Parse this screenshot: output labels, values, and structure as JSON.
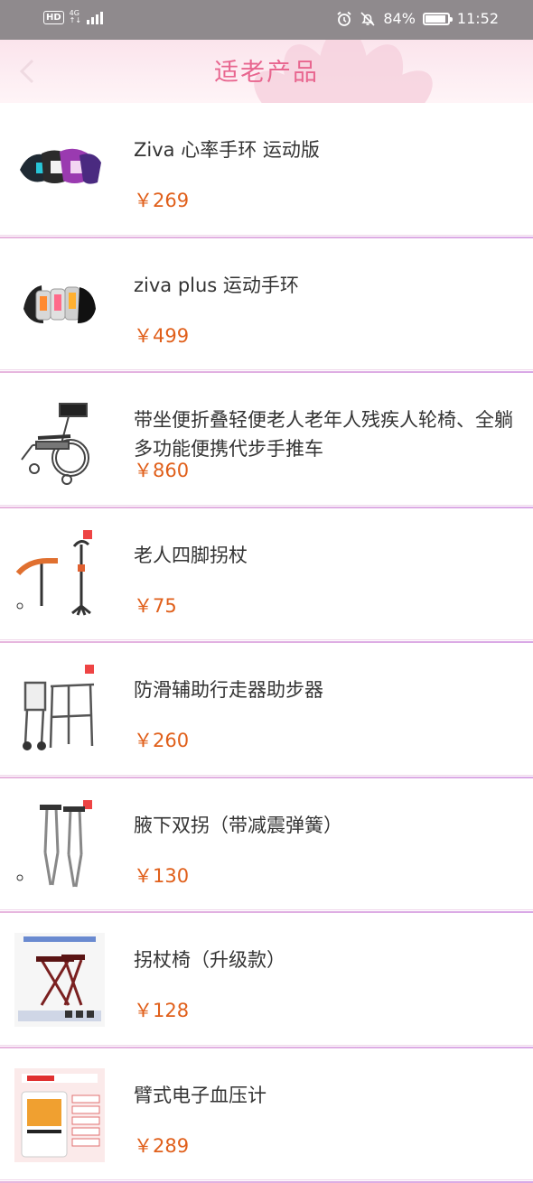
{
  "status_bar": {
    "hd": "HD",
    "network": "4G",
    "battery": "84%",
    "battery_level": 0.84,
    "time": "11:52"
  },
  "header": {
    "title": "适老产品"
  },
  "products": [
    {
      "name": "Ziva 心率手环 运动版",
      "price": "￥269",
      "icon": "fitness-band-icon"
    },
    {
      "name": "ziva plus  运动手环",
      "price": "￥499",
      "icon": "fitness-band-icon"
    },
    {
      "name": "带坐便折叠轻便老人老年人残疾人轮椅、全躺多功能便携代步手推车",
      "price": "￥860",
      "icon": "wheelchair-icon"
    },
    {
      "name": "老人四脚拐杖",
      "price": "￥75",
      "icon": "cane-icon"
    },
    {
      "name": "防滑辅助行走器助步器",
      "price": "￥260",
      "icon": "walker-icon"
    },
    {
      "name": "腋下双拐（带减震弹簧）",
      "price": "￥130",
      "icon": "crutches-icon"
    },
    {
      "name": "拐杖椅（升级款）",
      "price": "￥128",
      "icon": "cane-chair-icon"
    },
    {
      "name": "臂式电子血压计",
      "price": "￥289",
      "icon": "blood-pressure-monitor-icon"
    }
  ],
  "colors": {
    "title": "#e8668f",
    "price": "#e05f1a",
    "divider": "#e0b0e0"
  }
}
